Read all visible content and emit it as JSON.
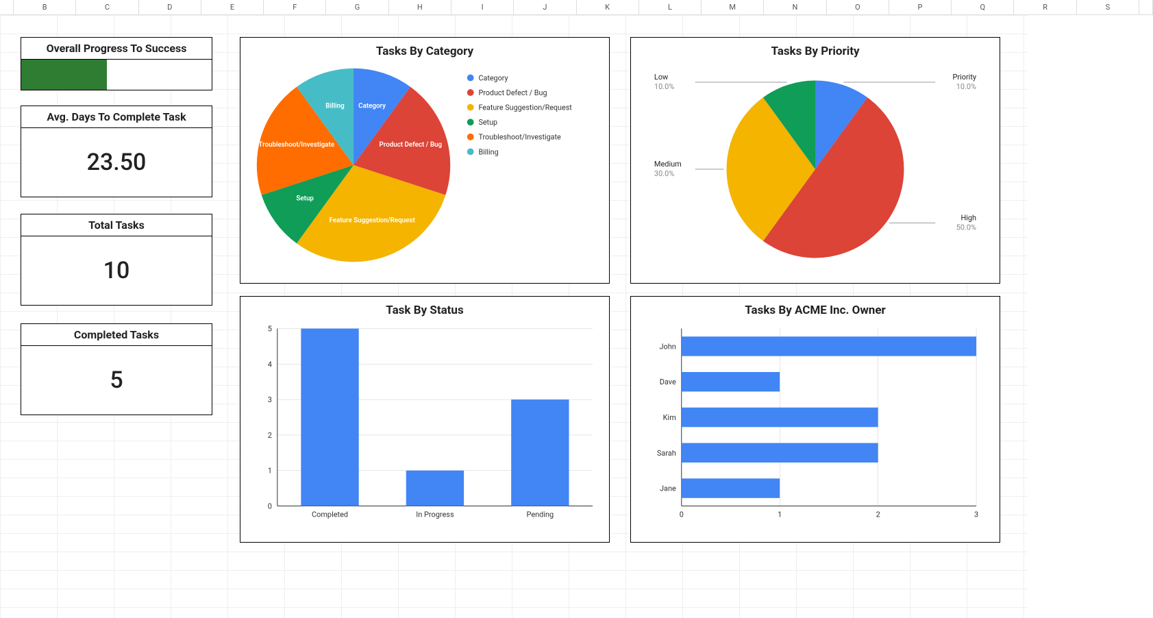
{
  "columns": [
    "",
    "B",
    "C",
    "D",
    "E",
    "F",
    "G",
    "H",
    "I",
    "J",
    "K",
    "L",
    "M",
    "N",
    "O",
    "P",
    "Q",
    "R",
    "S"
  ],
  "kpi": {
    "progress": {
      "title": "Overall Progress To Success",
      "fraction": 0.45
    },
    "avg_days": {
      "title": "Avg. Days To Complete Task",
      "value": "23.50"
    },
    "total": {
      "title": "Total Tasks",
      "value": "10"
    },
    "completed": {
      "title": "Completed Tasks",
      "value": "5"
    }
  },
  "colors": {
    "blue": "#4285F4",
    "red": "#DB4437",
    "yellow": "#F4B400",
    "green": "#0F9D58",
    "orange": "#FF6D01",
    "teal": "#46BDC6",
    "progress_fill": "#2E7D32"
  },
  "chart_data": [
    {
      "id": "by_category",
      "type": "pie",
      "title": "Tasks By Category",
      "series": [
        {
          "name": "Category",
          "value": 1,
          "color": "blue"
        },
        {
          "name": "Product Defect / Bug",
          "value": 2,
          "color": "red"
        },
        {
          "name": "Feature Suggestion/Request",
          "value": 3,
          "color": "yellow"
        },
        {
          "name": "Setup",
          "value": 1,
          "color": "green"
        },
        {
          "name": "Troubleshoot/Investigate",
          "value": 2,
          "color": "orange"
        },
        {
          "name": "Billing",
          "value": 1,
          "color": "teal"
        }
      ],
      "legend": true
    },
    {
      "id": "by_priority",
      "type": "pie",
      "title": "Tasks By Priority",
      "series": [
        {
          "name": "Priority",
          "value": 10,
          "pct_label": "10.0%",
          "color": "blue"
        },
        {
          "name": "High",
          "value": 50,
          "pct_label": "50.0%",
          "color": "red"
        },
        {
          "name": "Medium",
          "value": 30,
          "pct_label": "30.0%",
          "color": "yellow"
        },
        {
          "name": "Low",
          "value": 10,
          "pct_label": "10.0%",
          "color": "green"
        }
      ],
      "legend": false
    },
    {
      "id": "by_status",
      "type": "bar",
      "title": "Task By Status",
      "categories": [
        "Completed",
        "In Progress",
        "Pending"
      ],
      "values": [
        5,
        1,
        3
      ],
      "ylim": [
        0,
        5
      ],
      "yticks": [
        0,
        1,
        2,
        3,
        4,
        5
      ]
    },
    {
      "id": "by_owner",
      "type": "hbar",
      "title": "Tasks By ACME Inc. Owner",
      "categories": [
        "John",
        "Dave",
        "Kim",
        "Sarah",
        "Jane"
      ],
      "values": [
        3,
        1,
        2,
        2,
        1
      ],
      "xlim": [
        0,
        3
      ],
      "xticks": [
        0,
        1,
        2,
        3
      ]
    }
  ]
}
